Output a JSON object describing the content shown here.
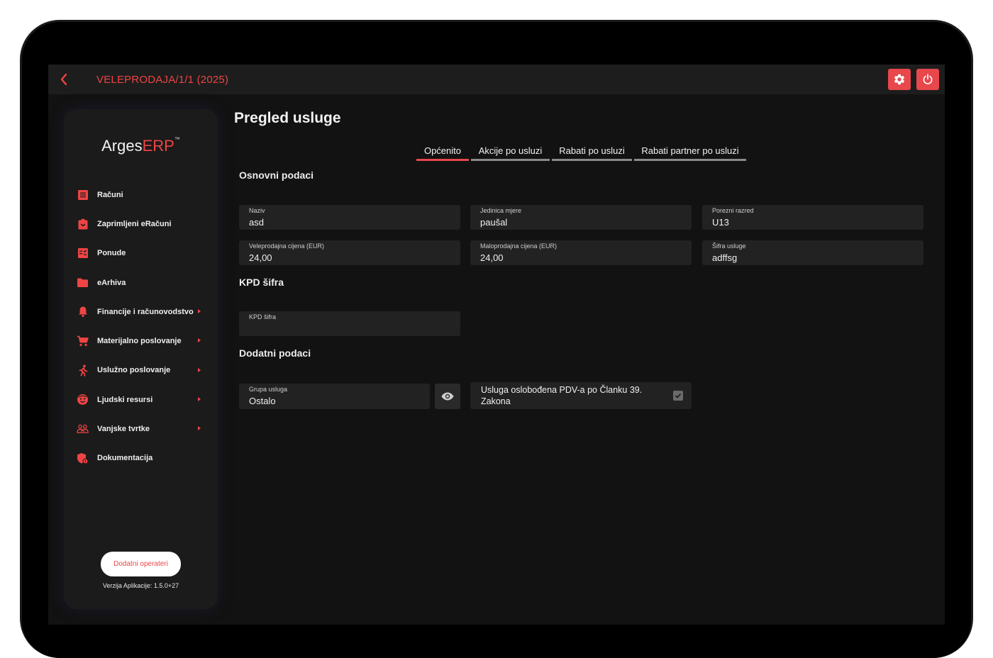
{
  "header": {
    "title": "VELEPRODAJA/1/1 (2025)"
  },
  "sidebar": {
    "logo_main": "Arges",
    "logo_accent": "ERP",
    "logo_tm": "™",
    "items": [
      {
        "label": "Računi",
        "icon": "receipt-icon",
        "has_submenu": false
      },
      {
        "label": "Zaprimljeni eRačuni",
        "icon": "clipboard-inbox-icon",
        "has_submenu": false
      },
      {
        "label": "Ponude",
        "icon": "offer-list-icon",
        "has_submenu": false
      },
      {
        "label": "eArhiva",
        "icon": "folder-icon",
        "has_submenu": false
      },
      {
        "label": "Financije i računovodstvo",
        "icon": "bell-icon",
        "has_submenu": true
      },
      {
        "label": "Materijalno poslovanje",
        "icon": "cart-icon",
        "has_submenu": true
      },
      {
        "label": "Uslužno poslovanje",
        "icon": "running-person-icon",
        "has_submenu": true
      },
      {
        "label": "Ljudski resursi",
        "icon": "face-icon",
        "has_submenu": true
      },
      {
        "label": "Vanjske tvrtke",
        "icon": "handshake-icon",
        "has_submenu": true
      },
      {
        "label": "Dokumentacija",
        "icon": "shield-doc-icon",
        "has_submenu": false
      }
    ],
    "operators_button": "Dodatni operateri",
    "version": "Verzija Aplikacije: 1.5.0+27"
  },
  "main": {
    "page_title": "Pregled usluge",
    "tabs": [
      {
        "label": "Općenito",
        "active": true
      },
      {
        "label": "Akcije po usluzi",
        "active": false
      },
      {
        "label": "Rabati po usluzi",
        "active": false
      },
      {
        "label": "Rabati partner po usluzi",
        "active": false
      }
    ],
    "sections": {
      "basic": "Osnovni podaci",
      "kpd": "KPD šifra",
      "extra": "Dodatni podaci"
    },
    "fields": {
      "naziv": {
        "label": "Naziv",
        "value": "asd"
      },
      "jedinica": {
        "label": "Jedinica mjere",
        "value": "paušal"
      },
      "porezni": {
        "label": "Porezni razred",
        "value": "U13"
      },
      "veleprodajna": {
        "label": "Veleprodajna cijena (EUR)",
        "value": "24,00"
      },
      "maloprodajna": {
        "label": "Maloprodajna cijena (EUR)",
        "value": "24,00"
      },
      "sifra": {
        "label": "Šifra usluge",
        "value": "adffsg"
      },
      "kpd": {
        "label": "KPD šifra",
        "value": ""
      },
      "grupa": {
        "label": "Grupa usluga",
        "value": "Ostalo"
      }
    },
    "pdv_exempt": {
      "label": "Usluga oslobođena PDV-a po Članku 39. Zakona",
      "checked": true
    }
  },
  "colors": {
    "accent": "#e8474b",
    "background": "#121212",
    "panel": "#1b1b1b",
    "field": "#222222"
  }
}
